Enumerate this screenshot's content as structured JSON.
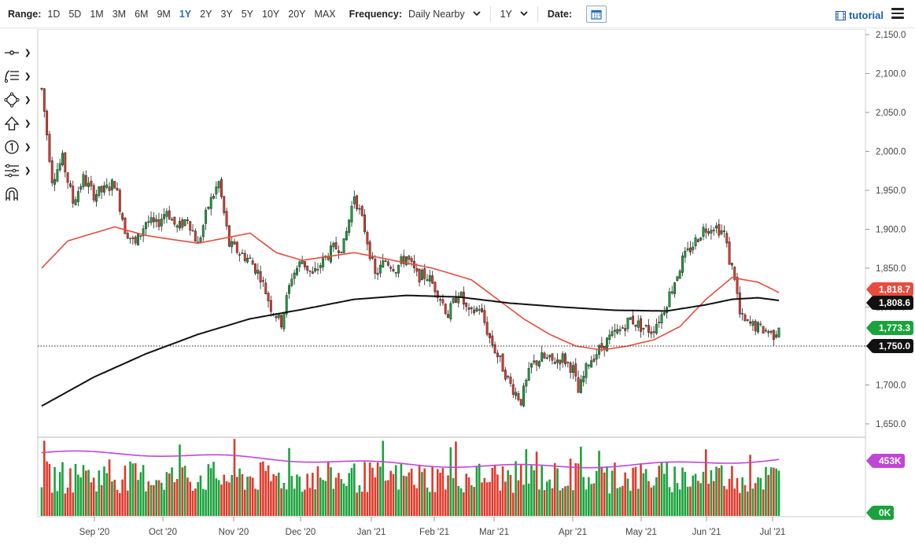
{
  "toolbar": {
    "range_label": "Range:",
    "ranges": [
      "1D",
      "5D",
      "1M",
      "3M",
      "6M",
      "9M",
      "1Y",
      "2Y",
      "3Y",
      "5Y",
      "10Y",
      "20Y",
      "MAX"
    ],
    "active_range": "1Y",
    "frequency_label": "Frequency:",
    "frequency_value": "Daily Nearby",
    "period_value": "1Y",
    "date_label": "Date:",
    "tutorial_label": "tutorial"
  },
  "sidebar_tools": [
    "crosshair-icon",
    "fibonacci-icon",
    "shape-icon",
    "arrow-up-icon",
    "number-marker-icon",
    "settings-sliders-icon",
    "magnet-icon"
  ],
  "colors": {
    "up": "#1aa33c",
    "down": "#e0392b",
    "ma50": "#e84c3d",
    "ma200": "#111111",
    "volume_avg": "#c046d6",
    "grid": "#dddddd",
    "accent": "#2a6fb5"
  },
  "chart_data": {
    "type": "candlestick",
    "price_axis": {
      "ylim": [
        1625,
        2160
      ],
      "ticks": [
        "2,150.0",
        "2,100.0",
        "2,050.0",
        "2,000.0",
        "1,950.0",
        "1,900.0",
        "1,850.0",
        "1,800.0",
        "1,750.0",
        "1,700.0",
        "1,650.0"
      ]
    },
    "x_labels": [
      "Sep '20",
      "Oct '20",
      "Nov '20",
      "Dec '20",
      "Jan '21",
      "Feb '21",
      "Mar '21",
      "Apr '21",
      "May '21",
      "Jun '21",
      "Jul '21"
    ],
    "price_path": [
      [
        0,
        2080
      ],
      [
        4,
        1965
      ],
      [
        8,
        1990
      ],
      [
        12,
        1935
      ],
      [
        16,
        1965
      ],
      [
        20,
        1945
      ],
      [
        24,
        1950
      ],
      [
        28,
        1960
      ],
      [
        32,
        1900
      ],
      [
        36,
        1880
      ],
      [
        40,
        1910
      ],
      [
        44,
        1905
      ],
      [
        48,
        1925
      ],
      [
        52,
        1900
      ],
      [
        56,
        1915
      ],
      [
        60,
        1880
      ],
      [
        64,
        1930
      ],
      [
        68,
        1960
      ],
      [
        72,
        1880
      ],
      [
        76,
        1870
      ],
      [
        80,
        1860
      ],
      [
        84,
        1840
      ],
      [
        88,
        1800
      ],
      [
        92,
        1780
      ],
      [
        96,
        1840
      ],
      [
        100,
        1860
      ],
      [
        104,
        1840
      ],
      [
        108,
        1860
      ],
      [
        112,
        1875
      ],
      [
        116,
        1880
      ],
      [
        120,
        1945
      ],
      [
        124,
        1900
      ],
      [
        128,
        1840
      ],
      [
        132,
        1860
      ],
      [
        136,
        1850
      ],
      [
        140,
        1865
      ],
      [
        144,
        1840
      ],
      [
        148,
        1840
      ],
      [
        152,
        1820
      ],
      [
        156,
        1790
      ],
      [
        160,
        1820
      ],
      [
        164,
        1790
      ],
      [
        168,
        1800
      ],
      [
        172,
        1760
      ],
      [
        176,
        1730
      ],
      [
        180,
        1700
      ],
      [
        184,
        1680
      ],
      [
        188,
        1725
      ],
      [
        192,
        1735
      ],
      [
        196,
        1730
      ],
      [
        200,
        1735
      ],
      [
        204,
        1720
      ],
      [
        206,
        1690
      ],
      [
        210,
        1730
      ],
      [
        214,
        1745
      ],
      [
        218,
        1760
      ],
      [
        222,
        1770
      ],
      [
        226,
        1785
      ],
      [
        230,
        1775
      ],
      [
        234,
        1770
      ],
      [
        238,
        1790
      ],
      [
        242,
        1825
      ],
      [
        246,
        1860
      ],
      [
        250,
        1880
      ],
      [
        254,
        1900
      ],
      [
        258,
        1905
      ],
      [
        262,
        1895
      ],
      [
        264,
        1860
      ],
      [
        266,
        1840
      ],
      [
        268,
        1790
      ],
      [
        270,
        1780
      ],
      [
        274,
        1775
      ],
      [
        278,
        1770
      ],
      [
        281,
        1765
      ],
      [
        282,
        1770
      ],
      [
        283,
        1773.3
      ]
    ],
    "ma50_path": [
      [
        0,
        1850
      ],
      [
        10,
        1885
      ],
      [
        20,
        1895
      ],
      [
        28,
        1903
      ],
      [
        40,
        1892
      ],
      [
        60,
        1882
      ],
      [
        80,
        1895
      ],
      [
        90,
        1870
      ],
      [
        100,
        1860
      ],
      [
        110,
        1865
      ],
      [
        120,
        1870
      ],
      [
        135,
        1860
      ],
      [
        150,
        1850
      ],
      [
        165,
        1835
      ],
      [
        175,
        1810
      ],
      [
        185,
        1785
      ],
      [
        195,
        1765
      ],
      [
        205,
        1750
      ],
      [
        215,
        1745
      ],
      [
        225,
        1750
      ],
      [
        235,
        1758
      ],
      [
        245,
        1775
      ],
      [
        255,
        1810
      ],
      [
        265,
        1838
      ],
      [
        275,
        1832
      ],
      [
        283,
        1818.7
      ]
    ],
    "ma200_path": [
      [
        0,
        1673
      ],
      [
        20,
        1710
      ],
      [
        40,
        1740
      ],
      [
        60,
        1765
      ],
      [
        80,
        1785
      ],
      [
        100,
        1797
      ],
      [
        120,
        1810
      ],
      [
        140,
        1815
      ],
      [
        160,
        1813
      ],
      [
        180,
        1805
      ],
      [
        200,
        1800
      ],
      [
        220,
        1796
      ],
      [
        240,
        1795
      ],
      [
        255,
        1803
      ],
      [
        265,
        1810
      ],
      [
        275,
        1812
      ],
      [
        283,
        1808.6
      ]
    ],
    "volume": {
      "ylim": [
        0,
        600
      ],
      "avg_level": 453,
      "labels": [
        "453K",
        "0K"
      ]
    },
    "reference_line": 1750.0,
    "last_values": {
      "ma50": "1,818.7",
      "ma200": "1,808.6",
      "price": "1,773.3",
      "reference": "1,750.0"
    }
  }
}
